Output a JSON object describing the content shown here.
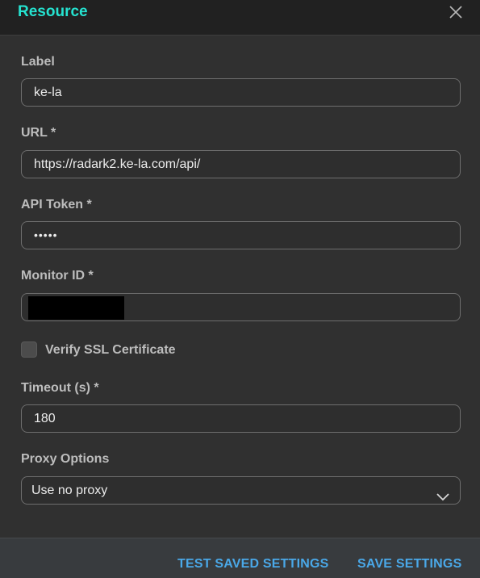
{
  "dialog": {
    "title": "Resource",
    "close_icon": "close-icon"
  },
  "fields": {
    "label": {
      "label": "Label",
      "value": "ke-la"
    },
    "url": {
      "label": "URL *",
      "value": "https://radark2.ke-la.com/api/"
    },
    "api_token": {
      "label": "API Token *",
      "value": "•••••"
    },
    "monitor_id": {
      "label": "Monitor ID *",
      "value": ""
    },
    "verify_ssl": {
      "label": "Verify SSL Certificate",
      "checked": false
    },
    "timeout": {
      "label": "Timeout (s) *",
      "value": "180"
    },
    "proxy": {
      "label": "Proxy Options",
      "selected": "Use no proxy",
      "icon": "chevron-down-icon"
    }
  },
  "footer": {
    "test_label": "TEST SAVED SETTINGS",
    "save_label": "SAVE SETTINGS"
  },
  "colors": {
    "title": "#25e3d0",
    "button": "#4aa8e8",
    "background": "#303030",
    "header": "#212121",
    "footer": "#383b3e"
  }
}
